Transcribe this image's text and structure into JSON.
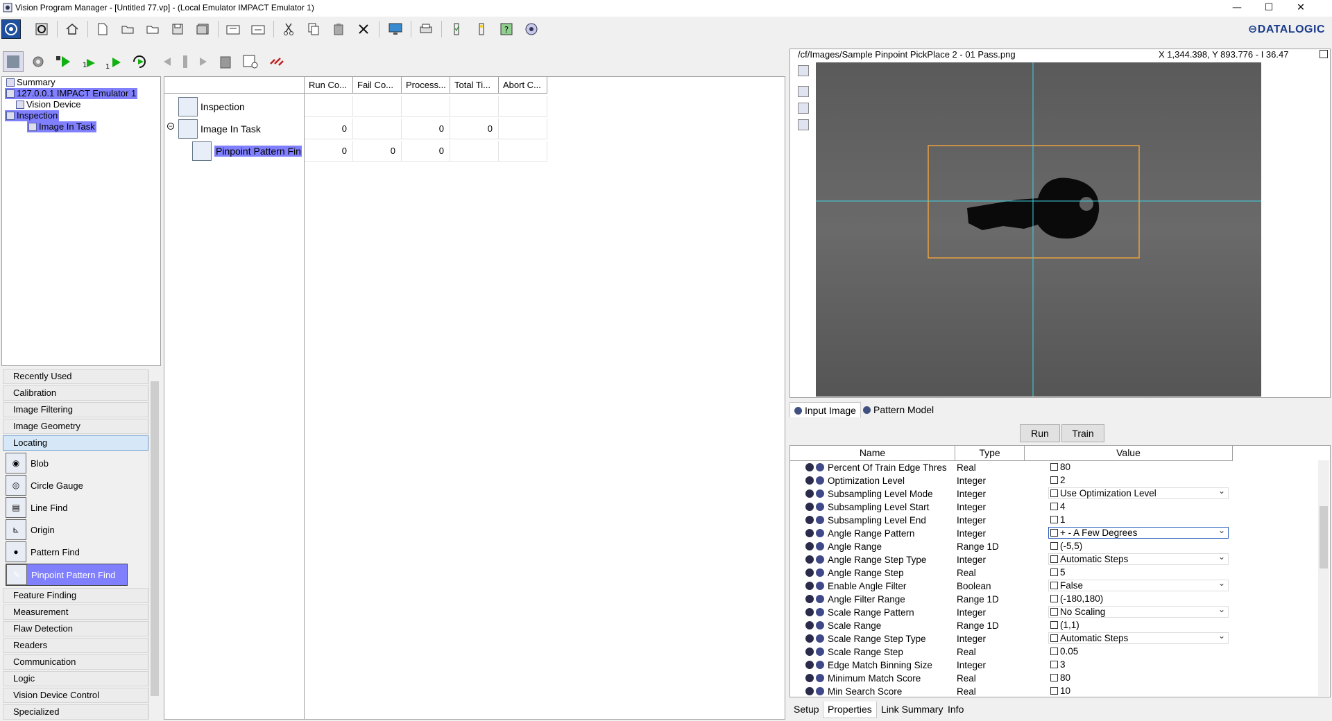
{
  "window": {
    "title": "Vision Program Manager - [Untitled 77.vp] - (Local Emulator IMPACT Emulator 1)",
    "min": "—",
    "max": "☐",
    "close": "✕",
    "brand": "⊖DATALOGIC"
  },
  "tree": {
    "nodes": [
      {
        "label": "Summary"
      },
      {
        "label": "127.0.0.1 IMPACT Emulator 1"
      },
      {
        "label": "Vision Device"
      },
      {
        "label": "Inspection"
      },
      {
        "label": "Image In Task"
      }
    ]
  },
  "toolbox": {
    "categories": [
      "Recently Used",
      "Calibration",
      "Image Filtering",
      "Image Geometry",
      "Locating",
      "Feature Finding",
      "Measurement",
      "Flaw Detection",
      "Readers",
      "Communication",
      "Logic",
      "Vision Device Control",
      "Specialized"
    ],
    "locating_tools": [
      "Blob",
      "Circle Gauge",
      "Line Find",
      "Origin",
      "Pattern Find",
      "Pinpoint Pattern Find"
    ]
  },
  "grid": {
    "headers": [
      "Run Co...",
      "Fail Co...",
      "Process...",
      "Total Ti...",
      "Abort C..."
    ],
    "rows": [
      {
        "name": "Inspection",
        "cells": [
          "",
          "",
          "",
          "",
          ""
        ]
      },
      {
        "name": "Image In Task",
        "cells": [
          "0",
          "",
          "0",
          "0",
          ""
        ]
      },
      {
        "name": "Pinpoint Pattern Fin",
        "cells": [
          "0",
          "0",
          "0",
          "",
          ""
        ]
      }
    ]
  },
  "image": {
    "path": "/cf/Images/Sample Pinpoint PickPlace 2 - 01 Pass.png",
    "coords": "X 1,344.398,  Y 893.776  - I 36.47"
  },
  "input_tabs": [
    "Input Image",
    "Pattern Model"
  ],
  "buttons": {
    "run": "Run",
    "train": "Train"
  },
  "props": {
    "headers": [
      "Name",
      "Type",
      "Value"
    ],
    "rows": [
      {
        "name": "Percent Of Train Edge Thres",
        "type": "Real",
        "value": "80"
      },
      {
        "name": "Optimization Level",
        "type": "Integer",
        "value": "2"
      },
      {
        "name": "Subsampling Level Mode",
        "type": "Integer",
        "value": "Use Optimization Level"
      },
      {
        "name": "Subsampling Level Start",
        "type": "Integer",
        "value": "4"
      },
      {
        "name": "Subsampling Level End",
        "type": "Integer",
        "value": "1"
      },
      {
        "name": "Angle Range Pattern",
        "type": "Integer",
        "value": "+ - A Few Degrees"
      },
      {
        "name": "Angle Range",
        "type": "Range 1D",
        "value": "(-5,5)"
      },
      {
        "name": "Angle Range Step Type",
        "type": "Integer",
        "value": "Automatic Steps"
      },
      {
        "name": "Angle Range Step",
        "type": "Real",
        "value": "5"
      },
      {
        "name": "Enable Angle Filter",
        "type": "Boolean",
        "value": "False"
      },
      {
        "name": "Angle Filter Range",
        "type": "Range 1D",
        "value": "(-180,180)"
      },
      {
        "name": "Scale Range Pattern",
        "type": "Integer",
        "value": "No Scaling"
      },
      {
        "name": "Scale Range",
        "type": "Range 1D",
        "value": "(1,1)"
      },
      {
        "name": "Scale Range Step Type",
        "type": "Integer",
        "value": "Automatic Steps"
      },
      {
        "name": "Scale Range Step",
        "type": "Real",
        "value": "0.05"
      },
      {
        "name": "Edge Match Binning Size",
        "type": "Integer",
        "value": "3"
      },
      {
        "name": "Minimum Match Score",
        "type": "Real",
        "value": "80"
      },
      {
        "name": "Min Search Score",
        "type": "Real",
        "value": "10"
      }
    ]
  },
  "bottom_tabs": [
    "Setup",
    "Properties",
    "Link Summary",
    "Info"
  ],
  "colors": {
    "selection": "#8080ff",
    "crosshair": "#40d0e0",
    "search_box": "#e8a040",
    "brand": "#1a3b8c"
  }
}
